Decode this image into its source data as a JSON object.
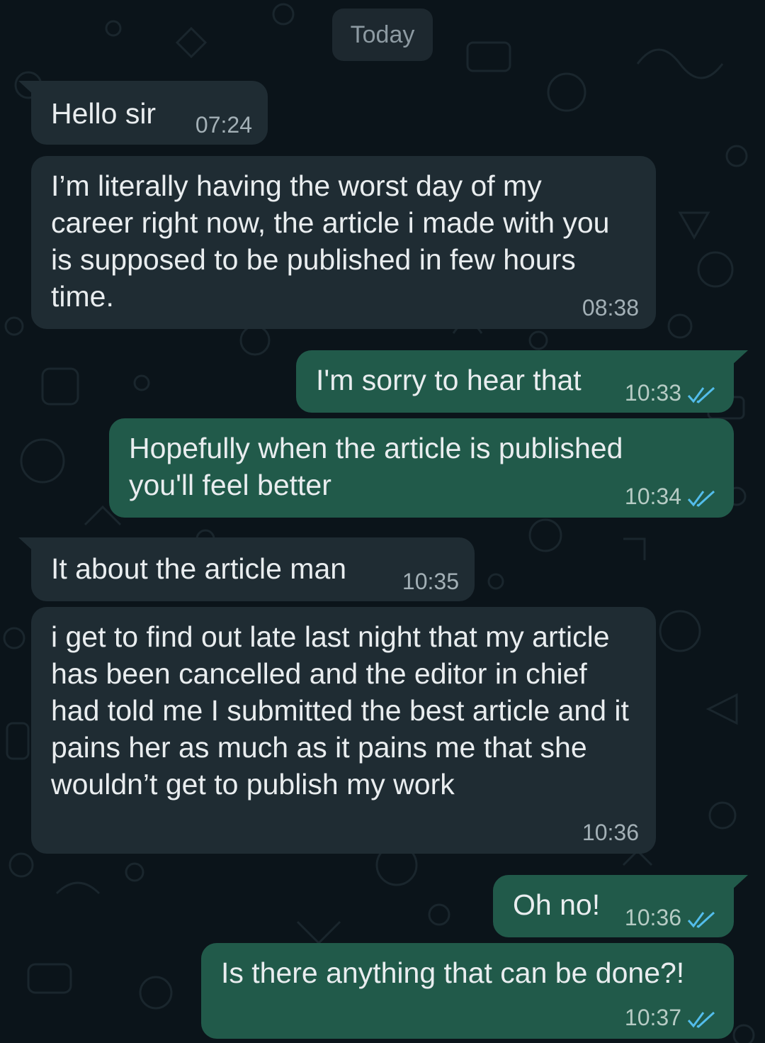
{
  "date_divider": "Today",
  "colors": {
    "background": "#0b141a",
    "incoming_bubble": "#1f2c33",
    "outgoing_bubble": "#215a4a",
    "read_tick": "#53bdeb"
  },
  "messages": [
    {
      "direction": "incoming",
      "text": "Hello sir",
      "time": "07:24"
    },
    {
      "direction": "incoming",
      "text": "I’m literally having the worst day of my career right now, the article i made with you is supposed to be published in few hours time.",
      "time": "08:38"
    },
    {
      "direction": "outgoing",
      "text": "I'm sorry to hear that",
      "time": "10:33",
      "status": "read-double-tick-icon"
    },
    {
      "direction": "outgoing",
      "text": "Hopefully when the article is published you'll feel better",
      "time": "10:34",
      "status": "read-double-tick-icon"
    },
    {
      "direction": "incoming",
      "text": "It about the article man",
      "time": "10:35"
    },
    {
      "direction": "incoming",
      "text": "i get to find out late last night that my article has been cancelled and the editor in chief had told me I submitted the best article and it pains her as much as it pains me that she wouldn’t get to publish my work",
      "time": "10:36"
    },
    {
      "direction": "outgoing",
      "text": "Oh no!",
      "time": "10:36",
      "status": "read-double-tick-icon"
    },
    {
      "direction": "outgoing",
      "text": "Is there anything that can be done?!",
      "time": "10:37",
      "status": "read-double-tick-icon"
    }
  ]
}
